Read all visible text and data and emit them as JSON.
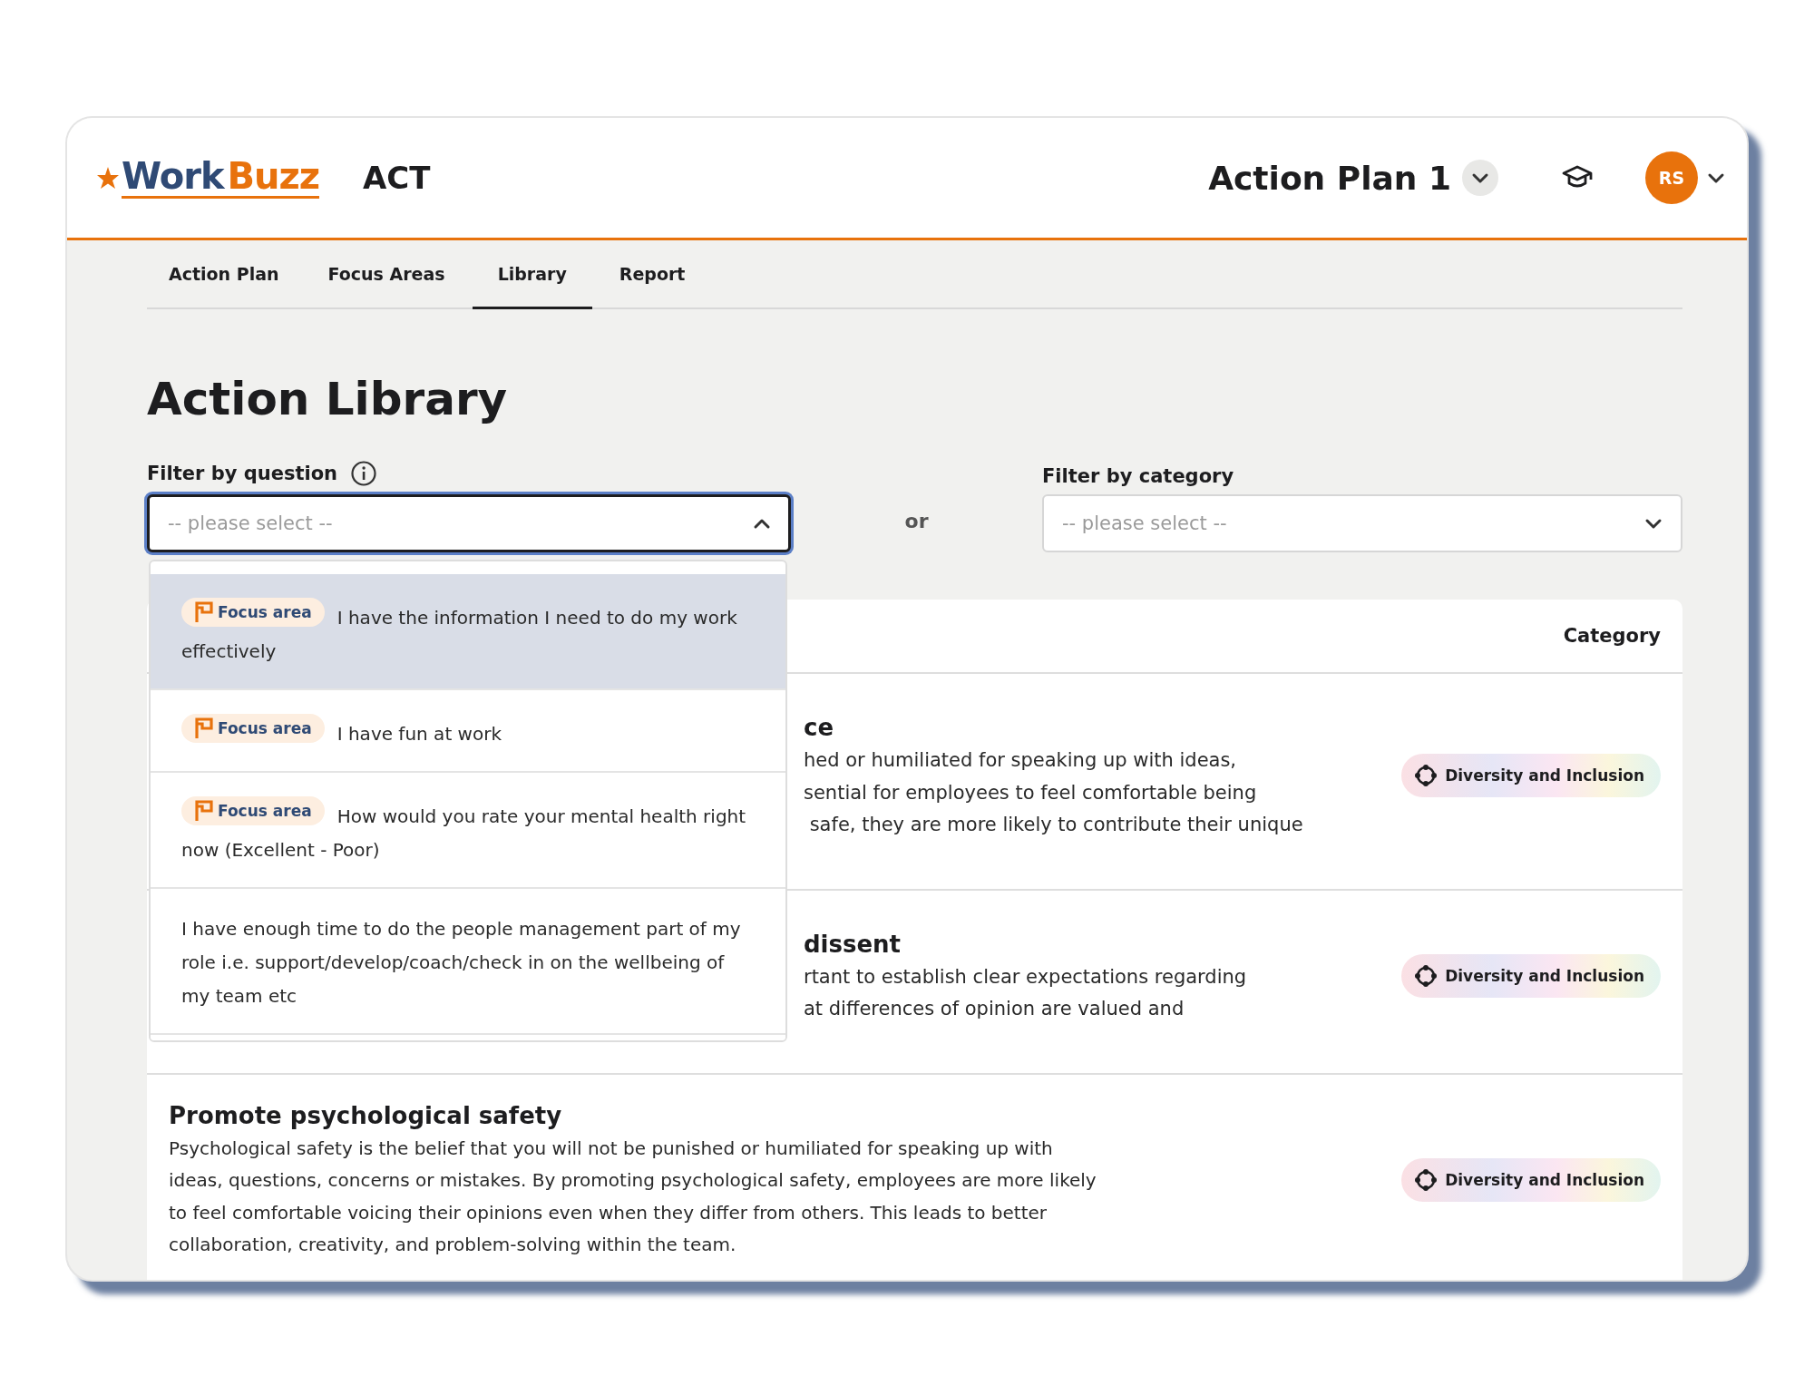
{
  "header": {
    "logo": [
      "Work",
      "Buzz"
    ],
    "product": "ACT",
    "plan_selector": {
      "label": "Action Plan 1"
    },
    "avatar": {
      "initials": "RS"
    }
  },
  "tabs": [
    {
      "label": "Action Plan",
      "selected": false
    },
    {
      "label": "Focus Areas",
      "selected": false
    },
    {
      "label": "Library",
      "selected": true
    },
    {
      "label": "Report",
      "selected": false
    }
  ],
  "page_title": "Action Library",
  "filters": {
    "question": {
      "label": "Filter by question",
      "placeholder": "-- please select --",
      "open": true,
      "options": [
        {
          "badge": "Focus area",
          "text": "I have the information I need to do my work effectively",
          "selected": true
        },
        {
          "badge": "Focus area",
          "text": "I have fun at work",
          "selected": false
        },
        {
          "badge": "Focus area",
          "text": "How would you rate your mental health right now (Excellent - Poor)",
          "selected": false
        },
        {
          "text": "I have enough time to do the people management part of my role i.e. support/develop/coach/check in on the wellbeing of my team etc",
          "selected": false
        }
      ]
    },
    "separator": "or",
    "category": {
      "label": "Filter by category",
      "placeholder": "-- please select --",
      "open": false
    }
  },
  "table": {
    "columns": [
      "Category"
    ],
    "rows": [
      {
        "kind": "partial",
        "title": "ce",
        "lines": [
          "hed or humiliated for speaking up with ideas,",
          "sential for employees to feel comfortable being",
          " safe, they are more likely to contribute their unique"
        ],
        "category": "Diversity and Inclusion"
      },
      {
        "kind": "partial",
        "title": "dissent",
        "lines": [
          "rtant to establish clear expectations regarding",
          "at differences of opinion are valued and"
        ],
        "category": "Diversity and Inclusion"
      },
      {
        "kind": "full",
        "title": "Promote psychological safety",
        "lines": [
          "Psychological safety is the belief that you will not be punished or humiliated for speaking up with ideas, questions, concerns or mistakes. By promoting psychological safety, employees are more likely to feel comfortable voicing their opinions even when they differ from others. This leads to better collaboration, creativity, and problem-solving within the team."
        ],
        "category": "Diversity and Inclusion"
      }
    ]
  }
}
